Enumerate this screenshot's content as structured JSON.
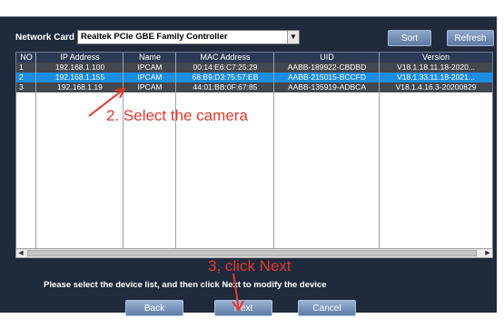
{
  "toolbar": {
    "network_card_label": "Network Card",
    "network_card_value": "Realtek PCIe GBE Family Controller",
    "sort_label": "Sort",
    "refresh_label": "Refresh"
  },
  "table": {
    "columns": [
      "NO",
      "IP Address",
      "Name",
      "MAC Address",
      "UID",
      "Version"
    ],
    "rows": [
      {
        "no": "1",
        "ip": "192.168.1.100",
        "name": "IPCAM",
        "mac": "00:14:E6:C7:25:29",
        "uid": "AABB-189922-CBDBD",
        "version": "V18.1.18.11.18-2020..."
      },
      {
        "no": "2",
        "ip": "192.168.1.155",
        "name": "IPCAM",
        "mac": "68:B9:D3:75:57:EB",
        "uid": "AABB-215015-BCCFD",
        "version": "V18.1.33.11.18-2021..."
      },
      {
        "no": "3",
        "ip": "192.168.1.19",
        "name": "IPCAM",
        "mac": "44:01:BB:0F:67:85",
        "uid": "AABB-135919-ADBCA",
        "version": "V18.1.4.16.3-20200829"
      }
    ],
    "selected_row": 2
  },
  "footer": {
    "instruction": "Please select the device list, and then click Next to modify the device",
    "back_label": "Back",
    "next_label": "Next",
    "cancel_label": "Cancel"
  },
  "annotations": {
    "step2": "2. Select the camera",
    "step3": "3, click Next",
    "color": "#e0382d"
  },
  "colors": {
    "window_bg": "#1f2a3c",
    "selected_row": "#1a8de3",
    "row_bg": "#43474e"
  }
}
